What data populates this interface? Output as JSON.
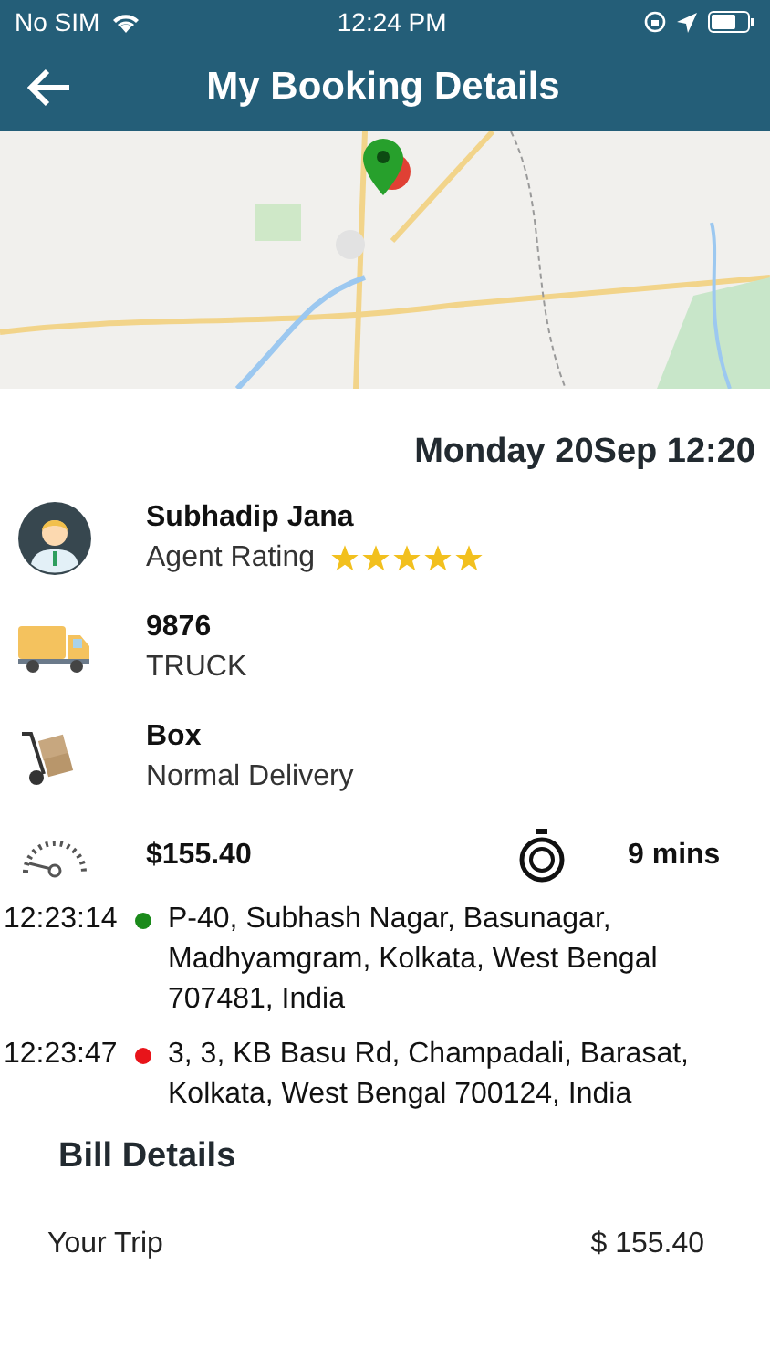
{
  "status_bar": {
    "carrier": "No SIM",
    "time": "12:24 PM"
  },
  "header": {
    "title": "My Booking Details"
  },
  "booking_date": "Monday 20Sep 12:20",
  "agent": {
    "name": "Subhadip Jana",
    "rating_label": "Agent Rating",
    "stars": 5
  },
  "vehicle": {
    "number": "9876",
    "type": "TRUCK"
  },
  "package": {
    "name": "Box",
    "delivery": "Normal Delivery"
  },
  "fare": "$155.40",
  "duration": "9 mins",
  "stops": [
    {
      "time": "12:23:14",
      "color": "#1a8a1a",
      "address": "P-40, Subhash Nagar, Basunagar, Madhyamgram, Kolkata, West Bengal 707481, India"
    },
    {
      "time": "12:23:47",
      "color": "#e8141a",
      "address": "3, 3, KB Basu Rd, Champadali, Barasat, Kolkata, West Bengal 700124, India"
    }
  ],
  "bill": {
    "title": "Bill Details",
    "lines": [
      {
        "label": "Your Trip",
        "amount": "$ 155.40"
      }
    ]
  }
}
